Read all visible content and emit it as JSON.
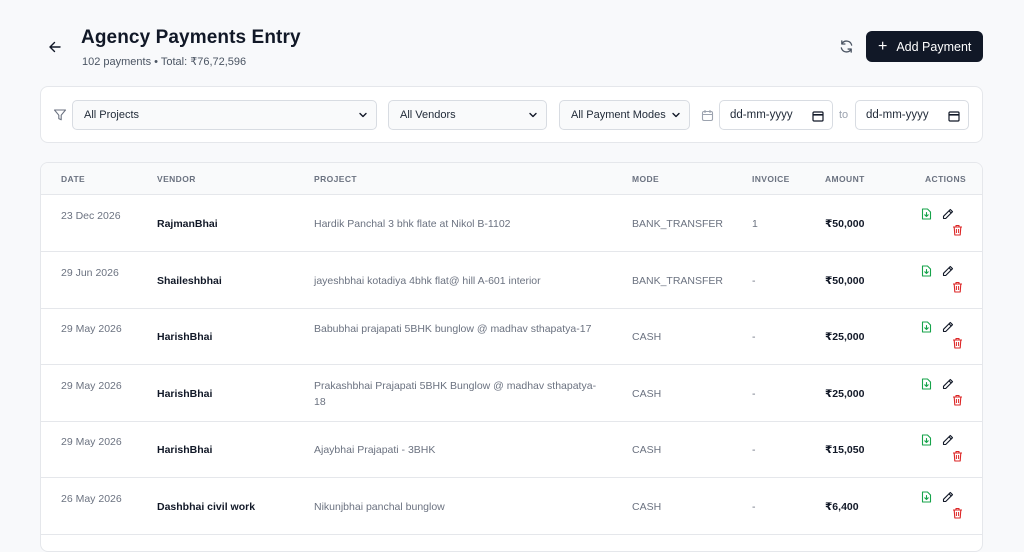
{
  "header": {
    "title": "Agency Payments Entry",
    "subtitle": "102 payments • Total: ₹76,72,596",
    "add_button": "Add Payment"
  },
  "filters": {
    "project": "All Projects",
    "vendor": "All Vendors",
    "mode": "All Payment Modes",
    "date_from": "dd-mm-yyyy",
    "to_label": "to",
    "date_to": "dd-mm-yyyy"
  },
  "table": {
    "columns": [
      "DATE",
      "VENDOR",
      "PROJECT",
      "MODE",
      "INVOICE",
      "AMOUNT",
      "ACTIONS"
    ],
    "rows": [
      {
        "date": "23 Dec 2026",
        "vendor": "RajmanBhai",
        "project": "Hardik Panchal 3 bhk flate at Nikol B-1102",
        "mode": "BANK_TRANSFER",
        "invoice": "1",
        "amount": "₹50,000"
      },
      {
        "date": "29 Jun 2026",
        "vendor": "Shaileshbhai",
        "project": "jayeshbhai kotadiya 4bhk flat@ hill A-601 interior",
        "mode": "BANK_TRANSFER",
        "invoice": "-",
        "amount": "₹50,000"
      },
      {
        "date": "29 May 2026",
        "vendor": "HarishBhai",
        "project": "Babubhai prajapati 5BHK bunglow @ madhav sthapatya-17",
        "mode": "CASH",
        "invoice": "-",
        "amount": "₹25,000"
      },
      {
        "date": "29 May 2026",
        "vendor": "HarishBhai",
        "project": "Prakashbhai Prajapati 5BHK Bunglow @ madhav sthapatya-18",
        "mode": "CASH",
        "invoice": "-",
        "amount": "₹25,000"
      },
      {
        "date": "29 May 2026",
        "vendor": "HarishBhai",
        "project": "Ajaybhai Prajapati - 3BHK",
        "mode": "CASH",
        "invoice": "-",
        "amount": "₹15,050"
      },
      {
        "date": "26 May 2026",
        "vendor": "Dashbhai civil work",
        "project": "Nikunjbhai panchal bunglow",
        "mode": "CASH",
        "invoice": "-",
        "amount": "₹6,400"
      }
    ]
  },
  "colors": {
    "primary": "#111827",
    "download_icon": "#16a34a",
    "delete_icon": "#dc2626"
  }
}
